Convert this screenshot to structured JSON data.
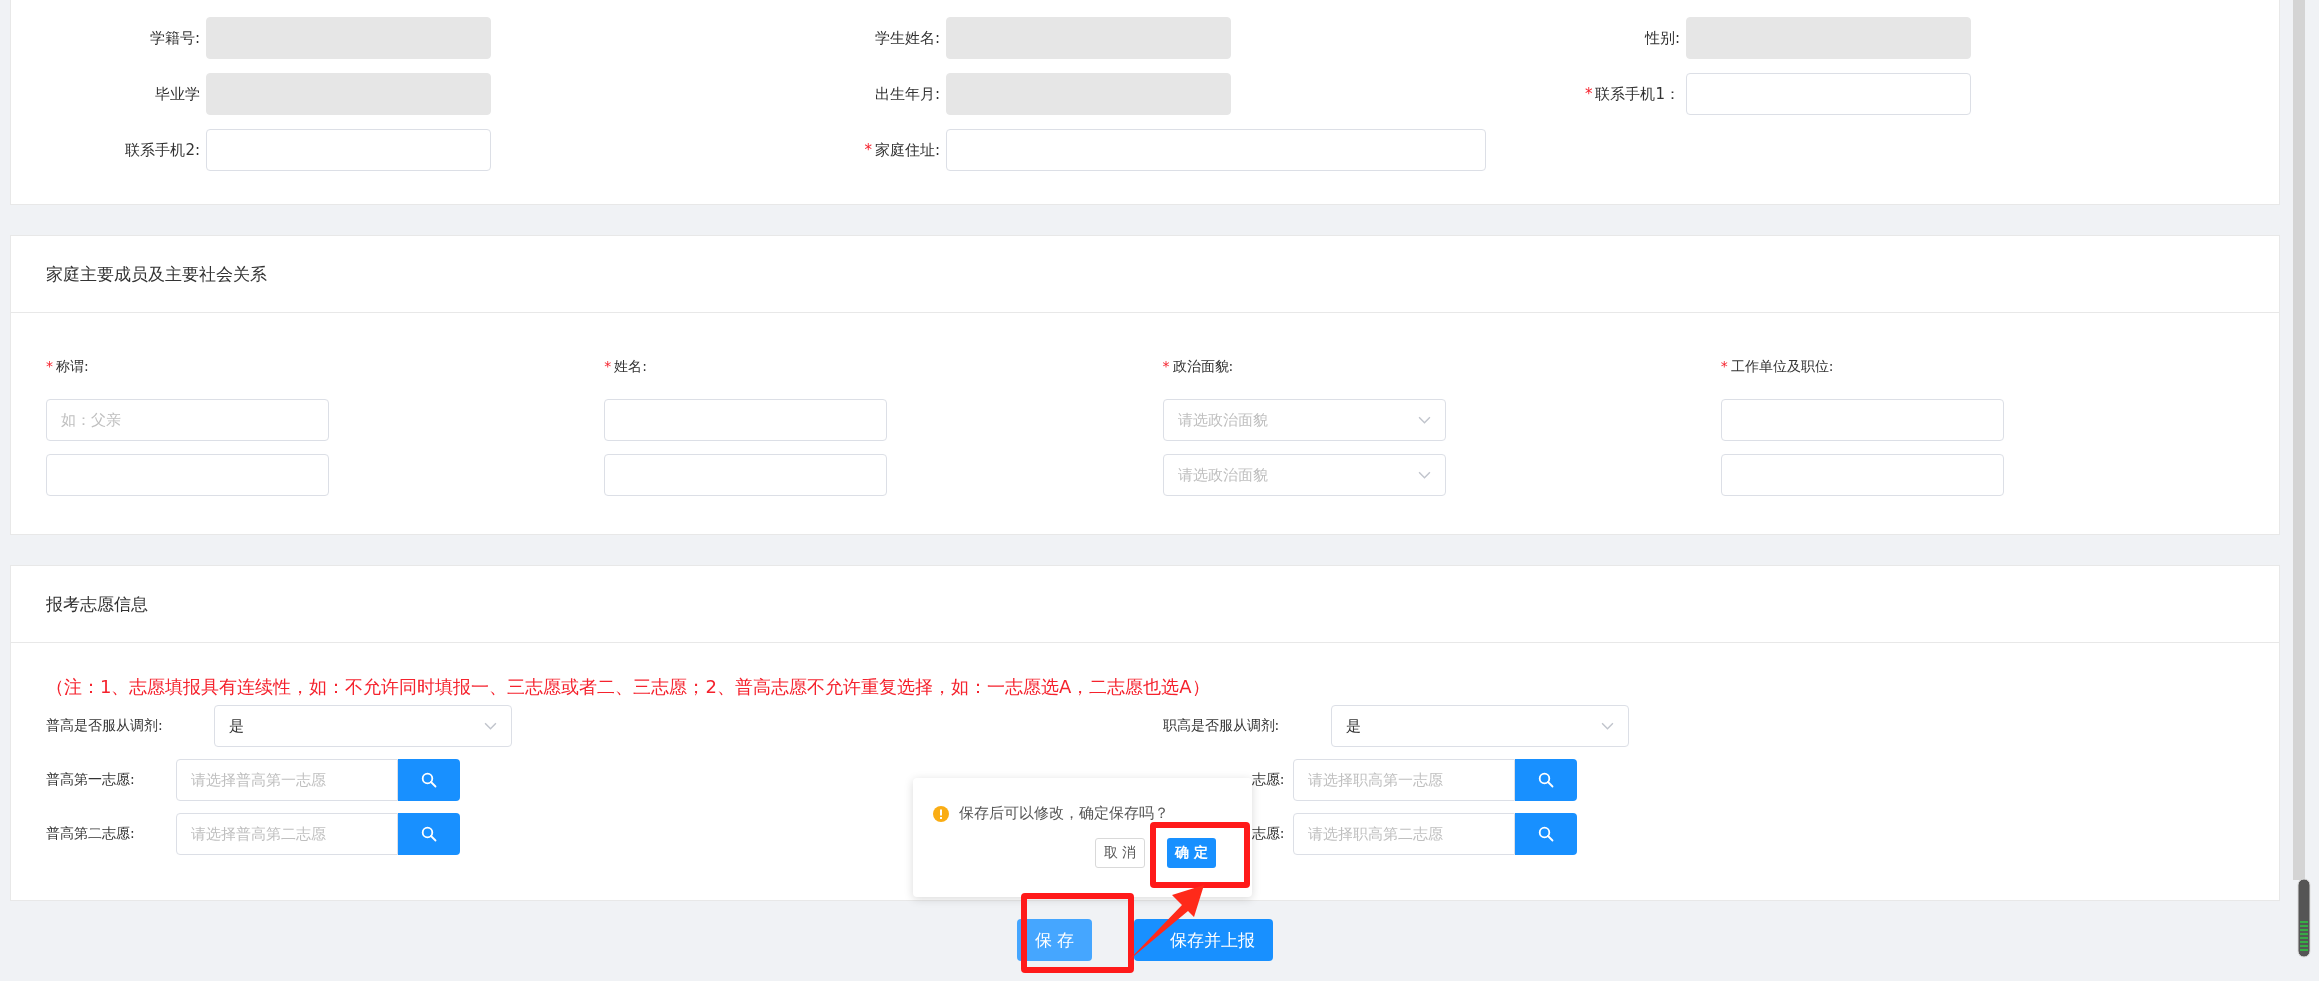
{
  "student_info": {
    "rows": [
      [
        {
          "label": "学籍号:",
          "field": {
            "disabled": true
          }
        },
        {
          "label": "学生姓名:",
          "field": {
            "disabled": true
          }
        },
        {
          "label": "性别:",
          "field": {
            "disabled": true
          }
        }
      ],
      [
        {
          "label": "毕业学",
          "field": {
            "disabled": true
          }
        },
        {
          "label": "出生年月:",
          "field": {
            "disabled": true
          }
        },
        {
          "label": "联系手机1：",
          "mark": "*",
          "field": {
            "disabled": false
          }
        }
      ],
      [
        {
          "label": "联系手机2:",
          "field": {
            "disabled": false
          }
        },
        {
          "label": "家庭住址:",
          "mark": "*",
          "field": {
            "disabled": false,
            "wide": true
          }
        }
      ]
    ]
  },
  "family": {
    "title": "家庭主要成员及主要社会关系",
    "columns": [
      {
        "label": "称谓:",
        "mark": "*",
        "kind": "input",
        "rows": [
          {
            "placeholder": "如：父亲"
          },
          {}
        ]
      },
      {
        "label": "姓名:",
        "mark": "*",
        "kind": "input",
        "rows": [
          {},
          {}
        ]
      },
      {
        "label": "政治面貌:",
        "mark": "*",
        "kind": "select",
        "rows": [
          {
            "placeholder": "请选政治面貌"
          },
          {
            "placeholder": "请选政治面貌"
          }
        ]
      },
      {
        "label": "工作单位及职位:",
        "mark": "*",
        "kind": "input",
        "rows": [
          {},
          {}
        ]
      }
    ]
  },
  "wishes": {
    "title": "报考志愿信息",
    "note": "（注：1、志愿填报具有连续性，如：不允许同时填报一、三志愿或者二、三志愿；2、普高志愿不允许重复选择，如：一志愿选A，二志愿也选A）",
    "sides": [
      {
        "rows": [
          {
            "kind": "select",
            "label": "普高是否服从调剂:",
            "value": "是"
          },
          {
            "kind": "search",
            "label": "普高第一志愿:",
            "placeholder": "请选择普高第一志愿"
          },
          {
            "kind": "search",
            "label": "普高第二志愿:",
            "placeholder": "请选择普高第二志愿"
          }
        ]
      },
      {
        "rows": [
          {
            "kind": "select",
            "label": "职高是否服从调剂:",
            "value": "是"
          },
          {
            "kind": "search",
            "label": "志愿:",
            "placeholder": "请选择职高第一志愿"
          },
          {
            "kind": "search",
            "label": "志愿:",
            "placeholder": "请选择职高第二志愿"
          }
        ]
      }
    ]
  },
  "popconfirm": {
    "message": "保存后可以修改，确定保存吗？",
    "cancel": "取 消",
    "confirm": "确 定"
  },
  "actions": [
    {
      "label": "保 存",
      "kind": "save"
    },
    {
      "label": "保存并上报",
      "kind": "submit"
    }
  ]
}
